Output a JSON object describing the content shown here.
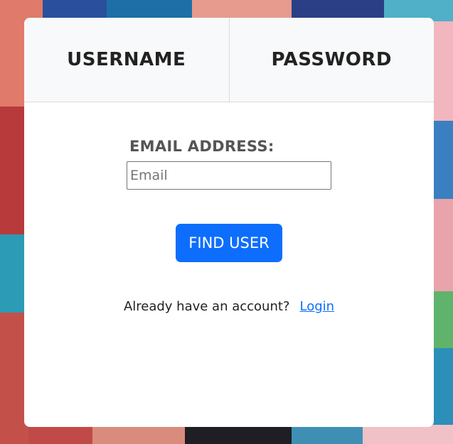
{
  "tabs": [
    {
      "label": "USERNAME"
    },
    {
      "label": "PASSWORD"
    }
  ],
  "form": {
    "email_label": "EMAIL ADDRESS:",
    "email_placeholder": "Email",
    "email_value": "",
    "submit_label": "FIND USER"
  },
  "footer": {
    "prompt": "Already have an account?",
    "login_link": "Login"
  },
  "colors": {
    "accent": "#0d6efd",
    "card": "#ffffff"
  }
}
